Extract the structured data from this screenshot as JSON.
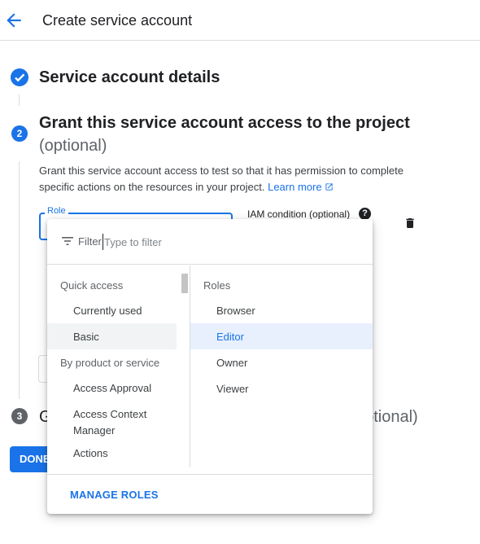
{
  "header": {
    "title": "Create service account"
  },
  "steps": {
    "step1": {
      "title": "Service account details"
    },
    "step2": {
      "number": "2",
      "title": "Grant this service account access to the project",
      "optional": "(optional)",
      "description": "Grant this service account access to test so that it has permission to complete specific actions on the resources in your project.",
      "learn_more": "Learn more"
    },
    "step3": {
      "number": "3",
      "title_visible": "G",
      "title_tail": "optional)"
    }
  },
  "role_field": {
    "label": "Role"
  },
  "iam_condition": {
    "label": "IAM condition (optional)",
    "help": "?"
  },
  "done_button": {
    "label": "DONE"
  },
  "dropdown": {
    "filter_label": "Filter",
    "filter_placeholder": "Type to filter",
    "left_column": {
      "quick_access_header": "Quick access",
      "quick_access": [
        "Currently used",
        "Basic"
      ],
      "product_header": "By product or service",
      "products": [
        "Access Approval",
        "Access Context\nManager",
        "Actions"
      ]
    },
    "right_column": {
      "header": "Roles",
      "roles": [
        "Browser",
        "Editor",
        "Owner",
        "Viewer"
      ],
      "selected": "Editor"
    },
    "footer": {
      "manage_roles": "MANAGE ROLES"
    }
  },
  "colors": {
    "accent": "#1a73e8",
    "selected_bg": "#e8f0fe",
    "hover_bg": "#f1f3f4"
  }
}
